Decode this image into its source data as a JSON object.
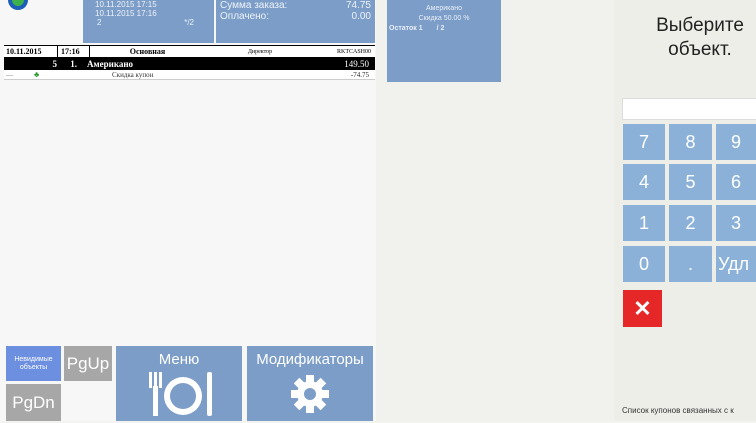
{
  "header": {
    "date_line1": "10.11.2015 17:15",
    "date_line2": "10.11.2015 17:16",
    "guests": "2",
    "table_ref": "*/2",
    "total_label": "Сумма заказа:",
    "total_value": "74.75",
    "paid_label": "Оплачено:",
    "paid_value": "0.00"
  },
  "order_table": {
    "date": "10.11.2015",
    "time": "17:16",
    "menu": "Основная",
    "role": "Директор",
    "code": "RKTCASH00",
    "items": [
      {
        "qty": "5",
        "num": "1.",
        "name": "Американо",
        "price": "149.50"
      }
    ],
    "discounts": [
      {
        "icon1": "—",
        "icon2": "♣",
        "name": "Скидка купон",
        "amount": "-74.75"
      }
    ]
  },
  "buttons": {
    "invisible": "Невидимые объекты",
    "pgup": "PgUp",
    "pgdn": "PgDn",
    "menu": "Меню",
    "modifiers": "Модификаторы"
  },
  "coupon_card": {
    "item": "Американо",
    "discount": "Скидка 50.00 %",
    "remain_label": "Остаток 1",
    "remain_total": "/ 2"
  },
  "keypad": {
    "prompt_line1": "Выберите",
    "prompt_line2": "объект.",
    "keys": [
      "7",
      "8",
      "9",
      "4",
      "5",
      "6",
      "1",
      "2",
      "3",
      "0",
      ".",
      "Удл"
    ],
    "cancel": "✕",
    "list_label": "Список купонов связанных с к"
  },
  "colors": {
    "tile_blue": "#7b9dc7",
    "key_blue": "#8bb1d8",
    "cancel_red": "#e52727"
  }
}
